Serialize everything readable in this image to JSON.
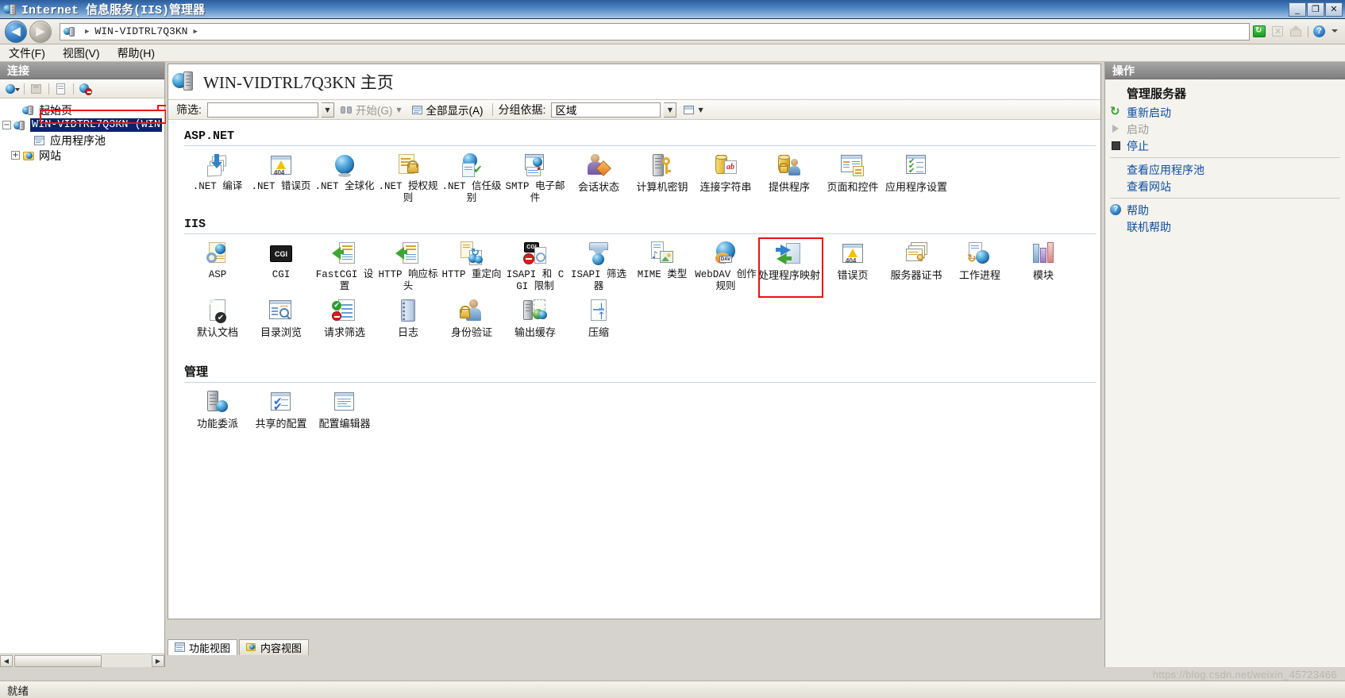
{
  "window": {
    "title": "Internet 信息服务(IIS)管理器",
    "title_icon": "iis-server-icon",
    "minimize_label": "_",
    "maximize_label": "❐",
    "close_label": "✕"
  },
  "address_bar": {
    "back_label": "◀",
    "forward_label": "▶",
    "icon": "server-icon",
    "path_segments": [
      "WIN-VIDTRL7Q3KN"
    ],
    "separator": "▶",
    "tools": [
      "refresh-icon",
      "stop-icon",
      "home-icon",
      "help-icon",
      "dropdown-icon"
    ]
  },
  "menu": {
    "items": [
      {
        "label": "文件(F)",
        "name": "menu-file"
      },
      {
        "label": "视图(V)",
        "name": "menu-view"
      },
      {
        "label": "帮助(H)",
        "name": "menu-help"
      }
    ]
  },
  "connections": {
    "header": "连接",
    "toolbar_icons": [
      "connect-to-icon",
      "save-icon",
      "edit-icon",
      "disconnect-icon"
    ],
    "tree": [
      {
        "label": "起始页",
        "icon": "start-page-icon",
        "expander": "",
        "selected": false,
        "indent": 1
      },
      {
        "label": "WIN-VIDTRL7Q3KN (WIN",
        "icon": "server-icon",
        "expander": "−",
        "selected": true,
        "indent": 0
      },
      {
        "label": "应用程序池",
        "icon": "app-pool-icon",
        "expander": "",
        "selected": false,
        "indent": 2
      },
      {
        "label": "网站",
        "icon": "sites-folder-icon",
        "expander": "+",
        "selected": false,
        "indent": 1
      }
    ]
  },
  "main": {
    "page_title": "WIN-VIDTRL7Q3KN 主页",
    "page_icon": "server-home-icon",
    "filter": {
      "label": "筛选:",
      "value": "",
      "placeholder": "",
      "go_label": "开始(G)",
      "go_icon": "binoculars-icon",
      "show_all_label": "全部显示(A)",
      "show_all_icon": "show-all-icon",
      "group_by_label": "分组依据:",
      "group_by_value": "区域",
      "view_icon": "view-mode-icon"
    },
    "groups": [
      {
        "title": "ASP.NET",
        "title_style": "ascii",
        "items": [
          {
            "label": ".NET 编译",
            "icon": "net-compilation-icon",
            "style": "ascii"
          },
          {
            "label": ".NET 错误页",
            "icon": "net-error-pages-icon",
            "style": "ascii"
          },
          {
            "label": ".NET 全球化",
            "icon": "net-globalization-icon",
            "style": "ascii"
          },
          {
            "label": ".NET 授权规则",
            "icon": "net-authorization-rules-icon",
            "style": "ascii"
          },
          {
            "label": ".NET 信任级别",
            "icon": "net-trust-levels-icon",
            "style": "ascii"
          },
          {
            "label": "SMTP 电子邮件",
            "icon": "smtp-email-icon",
            "style": "ascii"
          },
          {
            "label": "会话状态",
            "icon": "session-state-icon",
            "style": "cn"
          },
          {
            "label": "计算机密钥",
            "icon": "machine-key-icon",
            "style": "cn"
          },
          {
            "label": "连接字符串",
            "icon": "connection-strings-icon",
            "style": "cn"
          },
          {
            "label": "提供程序",
            "icon": "providers-icon",
            "style": "cn"
          },
          {
            "label": "页面和控件",
            "icon": "pages-and-controls-icon",
            "style": "cn"
          },
          {
            "label": "应用程序设置",
            "icon": "application-settings-icon",
            "style": "cn"
          }
        ]
      },
      {
        "title": "IIS",
        "title_style": "ascii",
        "items": [
          {
            "label": "ASP",
            "icon": "asp-icon",
            "style": "ascii"
          },
          {
            "label": "CGI",
            "icon": "cgi-icon",
            "style": "ascii"
          },
          {
            "label": "FastCGI 设置",
            "icon": "fastcgi-settings-icon",
            "style": "ascii"
          },
          {
            "label": "HTTP 响应标头",
            "icon": "http-response-headers-icon",
            "style": "ascii"
          },
          {
            "label": "HTTP 重定向",
            "icon": "http-redirect-icon",
            "style": "ascii"
          },
          {
            "label": "ISAPI 和 CGI 限制",
            "icon": "isapi-cgi-restrictions-icon",
            "style": "ascii"
          },
          {
            "label": "ISAPI 筛选器",
            "icon": "isapi-filters-icon",
            "style": "ascii"
          },
          {
            "label": "MIME 类型",
            "icon": "mime-types-icon",
            "style": "ascii"
          },
          {
            "label": "WebDAV 创作规则",
            "icon": "webdav-authoring-rules-icon",
            "style": "ascii"
          },
          {
            "label": "处理程序映射",
            "icon": "handler-mappings-icon",
            "style": "cn",
            "highlighted": true
          },
          {
            "label": "错误页",
            "icon": "error-pages-icon",
            "style": "cn"
          },
          {
            "label": "服务器证书",
            "icon": "server-certificates-icon",
            "style": "cn"
          },
          {
            "label": "工作进程",
            "icon": "worker-processes-icon",
            "style": "cn"
          },
          {
            "label": "模块",
            "icon": "modules-icon",
            "style": "cn"
          },
          {
            "label": "默认文档",
            "icon": "default-document-icon",
            "style": "cn"
          },
          {
            "label": "目录浏览",
            "icon": "directory-browsing-icon",
            "style": "cn"
          },
          {
            "label": "请求筛选",
            "icon": "request-filtering-icon",
            "style": "cn"
          },
          {
            "label": "日志",
            "icon": "logging-icon",
            "style": "cn"
          },
          {
            "label": "身份验证",
            "icon": "authentication-icon",
            "style": "cn"
          },
          {
            "label": "输出缓存",
            "icon": "output-caching-icon",
            "style": "cn"
          },
          {
            "label": "压缩",
            "icon": "compression-icon",
            "style": "cn"
          }
        ]
      },
      {
        "title": "管理",
        "title_style": "cn",
        "items": [
          {
            "label": "功能委派",
            "icon": "feature-delegation-icon",
            "style": "cn"
          },
          {
            "label": "共享的配置",
            "icon": "shared-configuration-icon",
            "style": "cn"
          },
          {
            "label": "配置编辑器",
            "icon": "configuration-editor-icon",
            "style": "cn"
          }
        ]
      }
    ],
    "view_tabs": [
      {
        "label": "功能视图",
        "icon": "features-view-icon",
        "active": true
      },
      {
        "label": "内容视图",
        "icon": "content-view-icon",
        "active": false
      }
    ]
  },
  "actions": {
    "header": "操作",
    "items": [
      {
        "label": "管理服务器",
        "type": "heading",
        "icon": ""
      },
      {
        "label": "重新启动",
        "type": "link",
        "icon": "restart-icon"
      },
      {
        "label": "启动",
        "type": "disabled",
        "icon": "start-icon"
      },
      {
        "label": "停止",
        "type": "link",
        "icon": "stop-icon"
      },
      {
        "label": "divider",
        "type": "divider",
        "icon": ""
      },
      {
        "label": "查看应用程序池",
        "type": "link",
        "icon": ""
      },
      {
        "label": "查看网站",
        "type": "link",
        "icon": ""
      },
      {
        "label": "divider",
        "type": "divider",
        "icon": ""
      },
      {
        "label": "帮助",
        "type": "link",
        "icon": "help-icon"
      },
      {
        "label": "联机帮助",
        "type": "link",
        "icon": ""
      }
    ]
  },
  "status": {
    "text": "就绪",
    "watermark": "https://blog.csdn.net/weixin_45723466"
  },
  "colors": {
    "title_bar": "#2c5d9b",
    "selection": "#0a246a",
    "link": "#0c4ea2",
    "annotation": "#ee1111",
    "pane_header": "#8f8f8f"
  }
}
